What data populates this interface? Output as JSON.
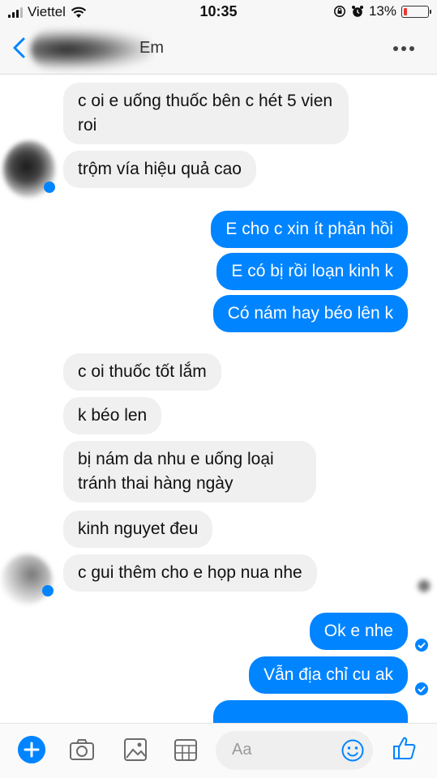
{
  "status_bar": {
    "carrier": "Viettel",
    "time": "10:35",
    "battery_percent": "13%",
    "battery_level": 0.13
  },
  "header": {
    "contact_name": "Em",
    "back_icon": "chevron-left-icon",
    "more_icon": "more-dots-icon"
  },
  "messages": [
    {
      "side": "in",
      "text": "c oi e uống thuốc bên c hét 5 vien roi"
    },
    {
      "side": "in",
      "text": "trộm vía hiệu quả cao"
    },
    {
      "side": "out",
      "text": "E cho c xin ít phản hồi"
    },
    {
      "side": "out",
      "text": "E có bị rồi loạn kinh k"
    },
    {
      "side": "out",
      "text": "Có nám hay béo lên k"
    },
    {
      "side": "in",
      "text": "c oi thuốc tốt lắm"
    },
    {
      "side": "in",
      "text": "k béo len"
    },
    {
      "side": "in",
      "text": "bị nám da nhu e uống loại tránh thai hàng ngày"
    },
    {
      "side": "in",
      "text": "kinh nguyet đeu"
    },
    {
      "side": "in",
      "text": "c gui thêm cho e họp nua nhe"
    },
    {
      "side": "out",
      "text": "Ok e nhe"
    },
    {
      "side": "out",
      "text": "Vẫn địa chỉ cu ak"
    }
  ],
  "composer": {
    "placeholder": "Aa",
    "icons": [
      "plus-icon",
      "camera-icon",
      "image-icon",
      "sticker-icon",
      "emoji-icon",
      "like-icon"
    ]
  },
  "colors": {
    "accent": "#0084ff",
    "incoming_bubble": "#f0f0f0"
  }
}
